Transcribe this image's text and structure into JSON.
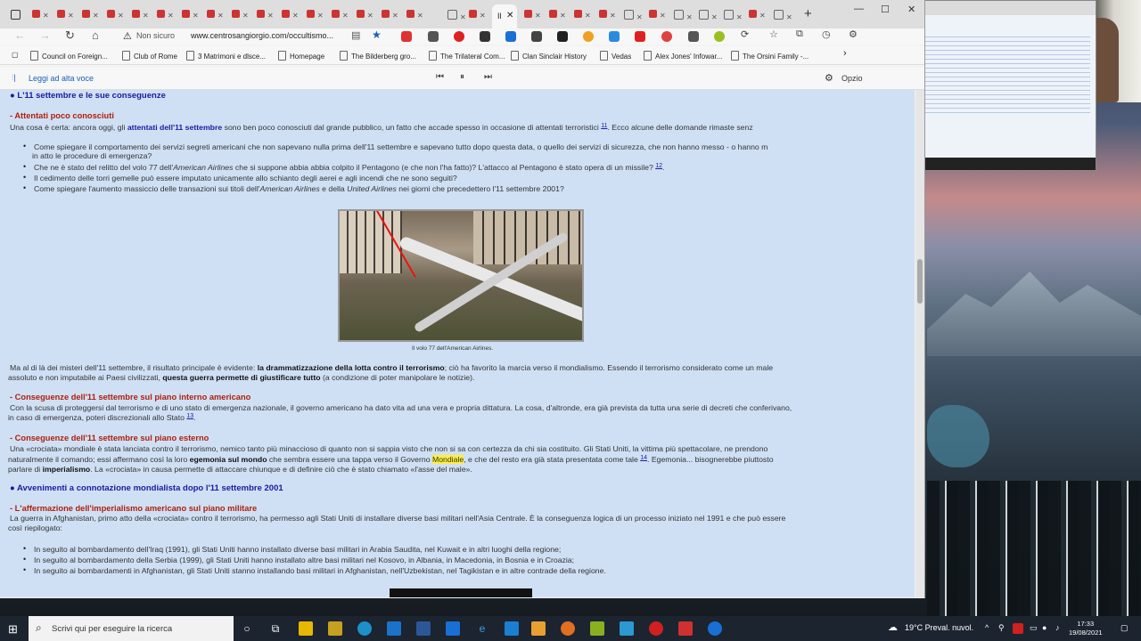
{
  "browser": {
    "active_tab_label": "Il",
    "nav": {
      "url_warning": "Non sicuro",
      "url": "www.centrosangiorgio.com/occultismo..."
    },
    "bookmarks": [
      "Council on Foreign...",
      "Club of Rome",
      "3 Matrimoni e dlsce...",
      "Homepage",
      "The Bilderberg gro...",
      "The Trilateral Com...",
      "Clan Sinclair History",
      "Vedas",
      "Alex Jones' Infowar...",
      "The Orsini Family -..."
    ],
    "read_aloud": {
      "label": "Leggi ad alta voce",
      "options": "Opzio"
    }
  },
  "article": {
    "section1": "L'11 settembre e le sue conseguenze",
    "sub1": "- Attentati poco conosciuti",
    "p1": {
      "a": "Una cosa è certa: ancora oggi, gli ",
      "b": "attentati dell'11 settembre",
      "c": " sono ben poco conosciuti dal grande pubblico, un fatto che accade spesso in occasione di attentati terroristici ",
      "ref": "11",
      "d": ". Ecco alcune delle domande rimaste senz"
    },
    "bullets1": [
      {
        "a": "Come spiegare il comportamento dei servizi segreti americani che non sapevano nulla prima dell'11 settembre e sapevano tutto dopo questa data, o quello dei servizi di sicurezza, che non hanno messo - o hanno m",
        "b": "in atto le procedure di emergenza?"
      },
      {
        "a": "Che ne è stato del relitto del volo 77 dell'",
        "i": "American Airlines",
        "c": " che si suppone abbia abbia colpito il Pentagono (e che non l'ha fatto)? L'attacco al Pentagono è stato opera di un missile? ",
        "ref": "12",
        "d": "."
      },
      {
        "a": "Il cedimento delle torri gemelle può essere imputato unicamente allo schianto degli aerei e agli incendi che ne sono seguiti?"
      },
      {
        "a": "Come spiegare l'aumento massiccio delle transazioni sui titoli dell'",
        "i": "American Airlines",
        "c": " e della ",
        "i2": "United Airlines",
        "d": " nei giorni che precedettero l'11 settembre 2001?"
      }
    ],
    "caption": "Il volo 77 dell'American Airlines.",
    "p2": {
      "a": "Ma al di là dei misteri dell'11 settembre, il risultato principale è evidente: ",
      "b": "la drammatizzazione della lotta contro il terrorismo",
      "c": "; ciò ha favorito la marcia verso il mondialismo. Essendo il terrorismo considerato come un male",
      "d": "assoluto e non imputabile ai Paesi civilizzati, ",
      "e": "questa guerra permette di giustificare tutto",
      "f": " (a condizione di poter manipolare le notizie)."
    },
    "sub2": "- Conseguenze dell'11 settembre sul piano interno americano",
    "p3": {
      "a": "Con la scusa di proteggersi dal terrorismo e di uno stato di emergenza nazionale, il governo americano ha dato vita ad una vera e propria dittatura. La cosa, d'altronde, era già prevista da tutta una serie di decreti che conferivano,",
      "b": "in caso di emergenza, poteri discrezionali allo Stato ",
      "ref": "13",
      "c": "."
    },
    "sub3": "- Conseguenze dell'11 settembre sul piano esterno",
    "p4": {
      "a": "Una «crociata» mondiale è stata lanciata contro il terrorismo, nemico tanto più minaccioso di quanto non si sappia visto che non si sa con certezza da chi sia costituito. Gli Stati Uniti, la vittima più spettacolare, ne prendono",
      "b": "naturalmente il comando; essi affermano così la loro ",
      "c": "egemonia sul mondo",
      "d": " che sembra essere una tappa verso il Governo ",
      "hl": "Mondiale",
      "e": ", e che del resto era già stata presentata come tale ",
      "ref": "14",
      "f": ". Egemonia... bisognerebbe piuttosto",
      "g": "parlare di ",
      "h": "imperialismo",
      "k": ". La «crociata» in causa permette di attaccare chiunque e di definire ciò che è stato chiamato «l'asse del male»."
    },
    "section2": "Avvenimenti a connotazione mondialista dopo l'11 settembre 2001",
    "sub4": "- L'affermazione dell'imperialismo americano sul piano militare",
    "p5": {
      "a": "La guerra in Afghanistan, primo atto della «crociata» contro il terrorismo, ha permesso agli Stati Uniti di installare diverse basi militari nell'Asia Centrale. È la conseguenza logica di un processo iniziato nel 1991 e che può essere",
      "b": "così riepilogato:"
    },
    "bullets2": [
      "In seguito al bombardamento dell'Iraq (1991), gli Stati Uniti hanno installato diverse basi militari in Arabia Saudita, nel Kuwait e in altri luoghi della regione;",
      "In seguito al bombardamento della Serbia (1999), gli Stati Uniti hanno installato altre basi militari nel Kosovo, in Albania, in Macedonia, in Bosnia e in Croazia;",
      "In seguito ai bombardamenti in Afghanistan, gli Stati Uniti stanno installando basi militari in Afghanistan, nell'Uzbekistan, nel Tagikistan e in altre contrade della regione."
    ]
  },
  "taskbar": {
    "search_placeholder": "Scrivi qui per eseguire la ricerca",
    "weather": "19°C  Preval. nuvol.",
    "time": "17:33",
    "date": "19/08/2021"
  }
}
